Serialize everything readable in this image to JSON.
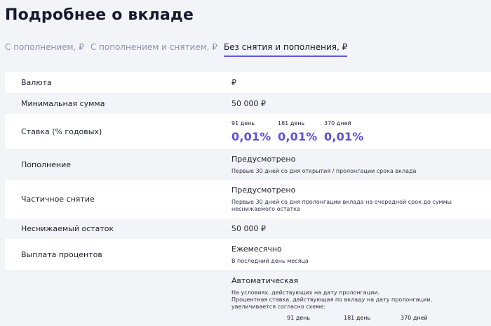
{
  "page_title": "Подробнее о вкладе",
  "tabs": [
    {
      "label": "С пополнением, ₽",
      "active": false
    },
    {
      "label": "С пополнением и снятием, ₽",
      "active": false
    },
    {
      "label": "Без снятия и пополнения, ₽",
      "active": true
    }
  ],
  "rows": {
    "currency": {
      "label": "Валюта",
      "value": "₽"
    },
    "min_sum": {
      "label": "Минимальная сумма",
      "value": "50 000 ₽"
    },
    "rate": {
      "label": "Ставка (% годовых)",
      "items": [
        {
          "period": "91 день",
          "value": "0,01%"
        },
        {
          "period": "181 день",
          "value": "0,01%"
        },
        {
          "period": "370 дней",
          "value": "0,01%"
        }
      ]
    },
    "replenish": {
      "label": "Пополнение",
      "value": "Предусмотрено",
      "note": "Первые 30 дней со дня открытия / пролонгации срока вклада"
    },
    "withdraw": {
      "label": "Частичное снятие",
      "value": "Предусмотрено",
      "note": "Первые 30 дней со дня пролонгации вклада на очередной срок до суммы неснижаемого остатка"
    },
    "min_balance": {
      "label": "Неснижаемый остаток",
      "value": "50 000 ₽"
    },
    "interest": {
      "label": "Выплата процентов",
      "value": "Ежемесячно",
      "note": "В последний день месяца"
    },
    "prolongation": {
      "label": "",
      "value": "Автоматическая",
      "note1": "На условиях, действующих на дату пролонгации.",
      "note2": "Процентная ставка, действующая по вкладу на дату пролонгации, увеличивается согласно схеме:",
      "periods": [
        "91 день",
        "181 день",
        "370 дней"
      ]
    }
  },
  "colors": {
    "accent": "#5b4fe0",
    "row_bg": "#ffffff",
    "page_bg": "#f3f4f8"
  }
}
